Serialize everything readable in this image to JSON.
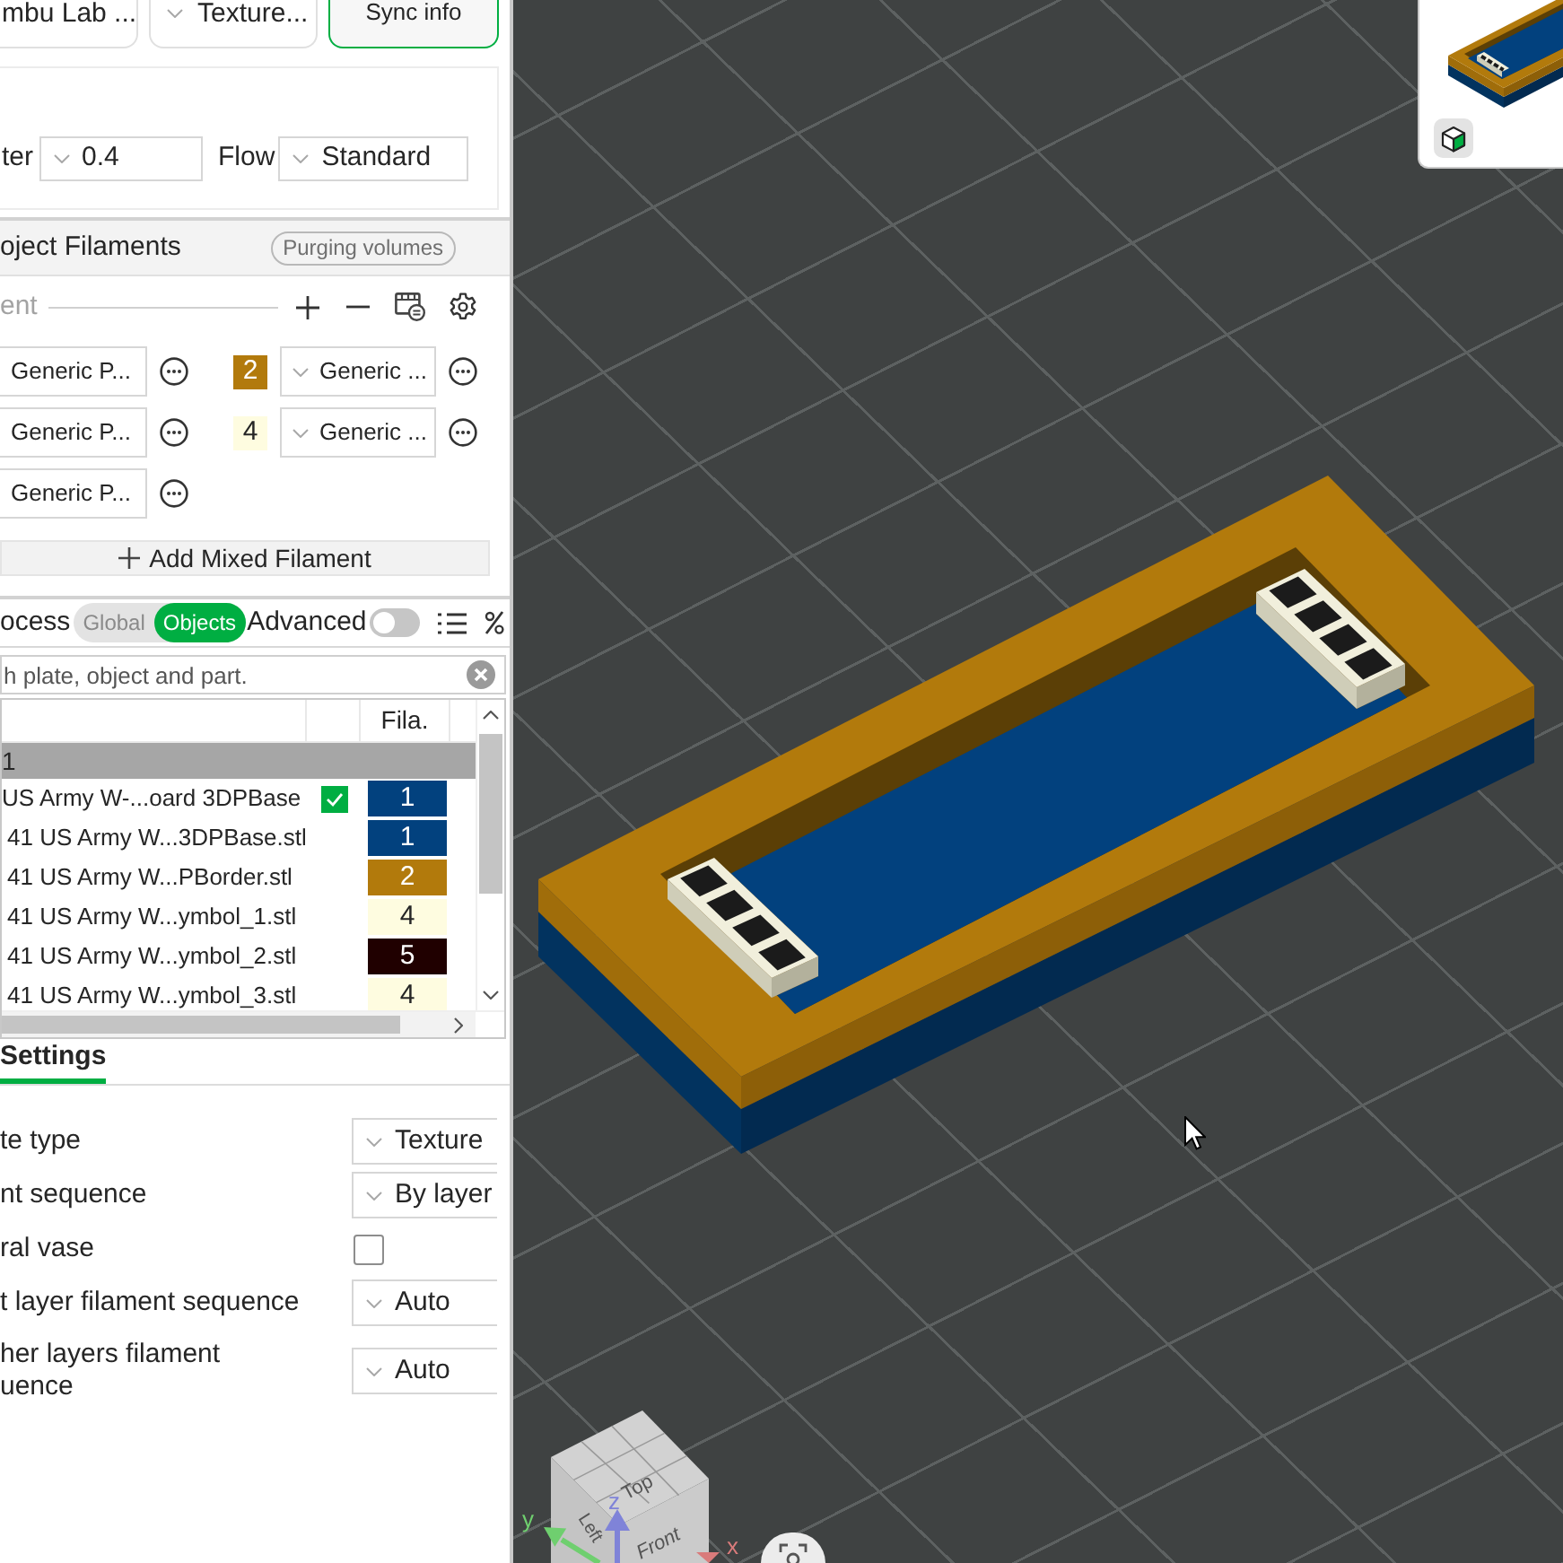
{
  "printer_bar": {
    "items": [
      {
        "kind": "card",
        "label": "mbu Lab ..."
      },
      {
        "kind": "dropdown",
        "label": "Texture..."
      },
      {
        "kind": "button",
        "label": "Sync info"
      }
    ]
  },
  "nozzle": {
    "diameter_label": "ter",
    "diameter": "0.4",
    "flow_label": "Flow",
    "flow": "Standard"
  },
  "project_filaments": {
    "title": "oject Filaments",
    "purge_button": "Purging volumes",
    "toolbar_label": "ent",
    "filaments": [
      {
        "kind": "partial",
        "value": "Generic P..."
      },
      {
        "kind": "numbered",
        "number": "2",
        "color": "#b27a0c",
        "value": "Generic ..."
      },
      {
        "kind": "partial",
        "value": "Generic P..."
      },
      {
        "kind": "numbered",
        "number": "4",
        "color": "#fefce0",
        "value": "Generic ..."
      },
      {
        "kind": "partial",
        "value": "Generic P..."
      }
    ],
    "add_button": "Add Mixed Filament"
  },
  "process": {
    "label": "ocess",
    "modes": [
      {
        "label": "Global",
        "selected": false
      },
      {
        "label": "Objects",
        "selected": true
      }
    ],
    "advanced_label": "Advanced",
    "advanced_on": false
  },
  "object_list": {
    "search_placeholder": "h plate, object and part.",
    "filament_header": "Fila.",
    "rows": [
      {
        "kind": "plate",
        "name": "1",
        "children": [
          {
            "kind": "object",
            "name": "US Army W-...oard 3DPBase",
            "checked": true,
            "filament": "1",
            "color": "#02417e",
            "children": [
              {
                "kind": "part",
                "name": "41 US Army W...3DPBase.stl",
                "filament": "1",
                "color": "#02417e"
              },
              {
                "kind": "part",
                "name": "41 US Army W...PBorder.stl",
                "filament": "2",
                "color": "#b27a0c"
              },
              {
                "kind": "part",
                "name": "41 US Army W...ymbol_1.stl",
                "filament": "4",
                "color": "#fefce0"
              },
              {
                "kind": "part",
                "name": "41 US Army W...ymbol_2.stl",
                "filament": "5",
                "color": "#200000"
              },
              {
                "kind": "part",
                "name": "41 US Army W...ymbol_3.stl",
                "filament": "4",
                "color": "#fefce0"
              }
            ]
          }
        ]
      }
    ]
  },
  "plate_settings": {
    "tab": {
      "label": "Settings",
      "selected": true
    },
    "rows": [
      {
        "kind": "dropdown",
        "label": "te type",
        "value": "Texture"
      },
      {
        "kind": "dropdown",
        "label": "nt sequence",
        "value": "By layer"
      },
      {
        "kind": "checkbox",
        "label": "ral vase",
        "checked": false
      },
      {
        "kind": "dropdown",
        "label": "t layer filament sequence",
        "value": "Auto"
      },
      {
        "kind": "dropdown",
        "label": "her layers filament\nuence",
        "value": "Auto"
      }
    ]
  },
  "viewport": {
    "view_cube": {
      "faces": [
        "Top",
        "Left",
        "Front"
      ],
      "axes": [
        "x",
        "y",
        "z"
      ]
    }
  }
}
